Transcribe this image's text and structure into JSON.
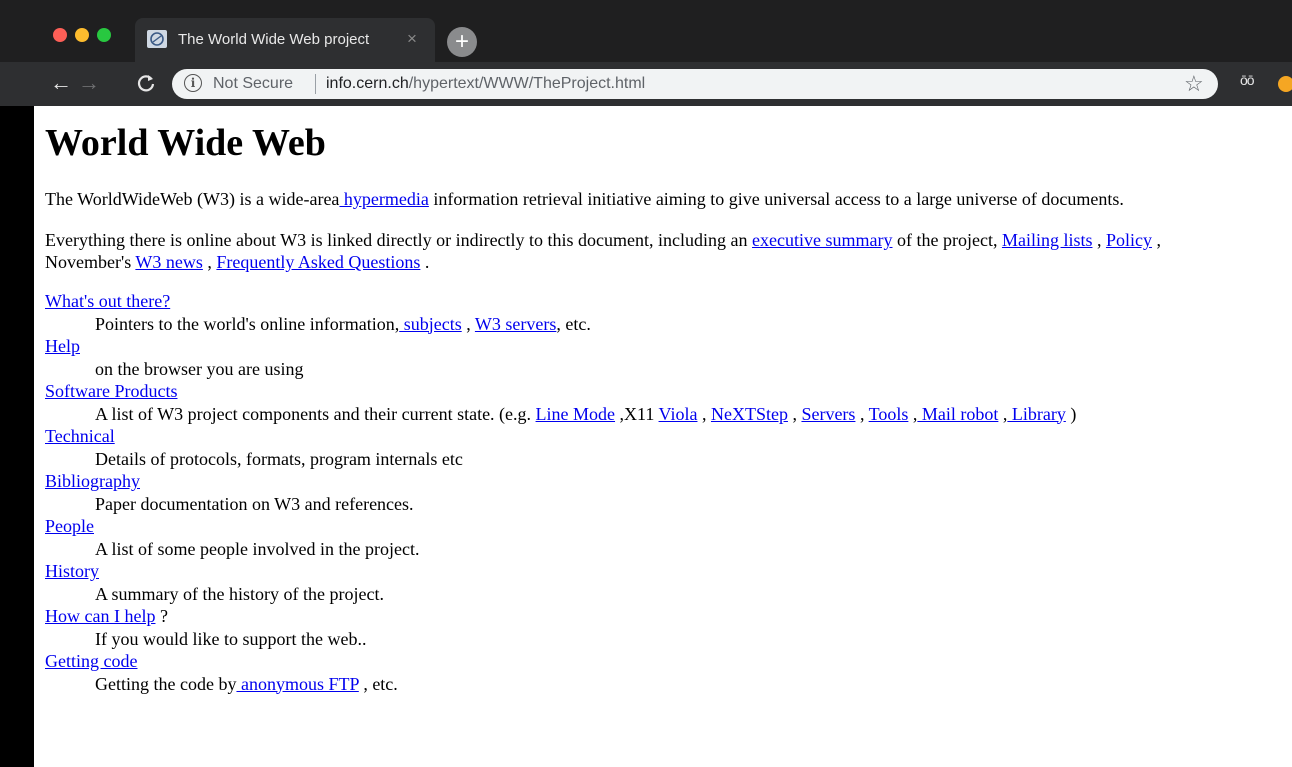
{
  "tab": {
    "title": "The World Wide Web project",
    "close": "×",
    "new_tab": "+"
  },
  "toolbar": {
    "back": "←",
    "forward": "→",
    "reload": "C",
    "security_label": "Not Secure",
    "url_host": "info.cern.ch",
    "url_path": "/hypertext/WWW/TheProject.html",
    "bookmark": "☆",
    "incognito": "ōō"
  },
  "page": {
    "heading": "World Wide Web",
    "intro": {
      "before": "The WorldWideWeb (W3) is a wide-area",
      "link": " hypermedia",
      "after": " information retrieval initiative aiming to give universal access to a large universe of documents."
    },
    "summary": {
      "t1": "Everything there is online about W3 is linked directly or indirectly to this document, including an ",
      "exec_summary": "executive summary",
      "t2": " of the project, ",
      "mailing_lists": "Mailing lists",
      "t3": " , ",
      "policy": "Policy",
      "t4": " ,",
      "t5": "November's ",
      "w3_news": "W3 news",
      "t6": " , ",
      "faq": "Frequently Asked Questions",
      "t7": " ."
    },
    "entries": {
      "whats_out_there": {
        "link": "What's out there?",
        "d1": "Pointers to the world's online information,",
        "subjects": " subjects",
        "d2": " , ",
        "w3_servers": "W3 servers",
        "d3": ", etc."
      },
      "help": {
        "link": "Help",
        "desc": "on the browser you are using"
      },
      "software": {
        "link": "Software Products",
        "d1": "A list of W3 project components and their current state. (e.g. ",
        "line_mode": "Line Mode",
        "d2": " ,X11 ",
        "viola": "Viola",
        "d3": " , ",
        "nextstep": "NeXTStep",
        "d4": " , ",
        "servers": "Servers",
        "d5": " , ",
        "tools": "Tools",
        "d6": " ,",
        "mail_robot": " Mail robot",
        "d7": " ,",
        "library": " Library",
        "d8": " )"
      },
      "technical": {
        "link": "Technical",
        "desc": "Details of protocols, formats, program internals etc"
      },
      "bibliography": {
        "link": "Bibliography",
        "desc": "Paper documentation on W3 and references."
      },
      "people": {
        "link": "People",
        "desc": "A list of some people involved in the project."
      },
      "history": {
        "link": "History",
        "desc": "A summary of the history of the project."
      },
      "how_help": {
        "link": "How can I help",
        "suffix": " ?",
        "desc": "If you would like to support the web.."
      },
      "getting_code": {
        "link": "Getting code",
        "d1": "Getting the code by",
        "ftp": " anonymous FTP",
        "d2": " , etc."
      }
    }
  },
  "colors": {
    "link": "#0000ee",
    "chrome_dark": "#1f1f20",
    "chrome_tab": "#2e2f31"
  }
}
